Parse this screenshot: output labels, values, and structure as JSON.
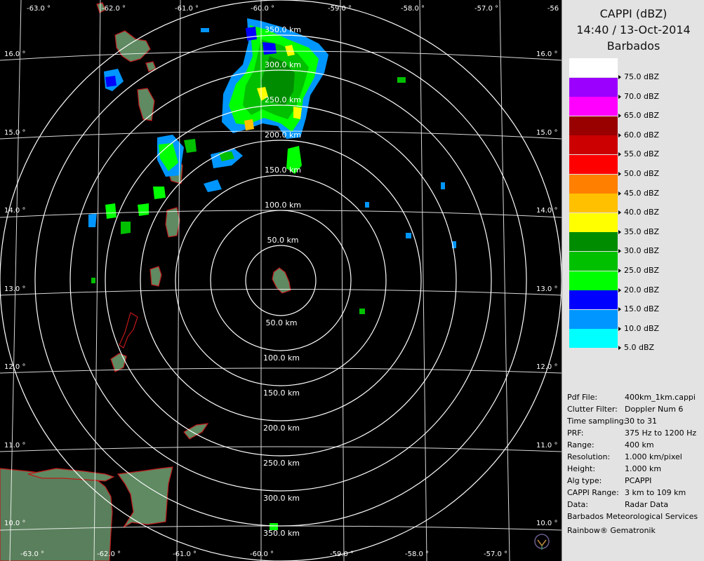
{
  "header": {
    "product": "CAPPI (dBZ)",
    "datetime": "14:40 / 13-Oct-2014",
    "site": "Barbados"
  },
  "legend": [
    {
      "label": "75.0 dBZ",
      "color": "#ffffff"
    },
    {
      "label": "70.0 dBZ",
      "color": "#9b00ff"
    },
    {
      "label": "65.0 dBZ",
      "color": "#ff00ff"
    },
    {
      "label": "60.0 dBZ",
      "color": "#990000"
    },
    {
      "label": "55.0 dBZ",
      "color": "#cc0000"
    },
    {
      "label": "50.0 dBZ",
      "color": "#ff0000"
    },
    {
      "label": "45.0 dBZ",
      "color": "#ff7f00"
    },
    {
      "label": "40.0 dBZ",
      "color": "#ffc000"
    },
    {
      "label": "35.0 dBZ",
      "color": "#ffff00"
    },
    {
      "label": "30.0 dBZ",
      "color": "#008c00"
    },
    {
      "label": "25.0 dBZ",
      "color": "#00c000"
    },
    {
      "label": "20.0 dBZ",
      "color": "#00ff00"
    },
    {
      "label": "15.0 dBZ",
      "color": "#0000ff"
    },
    {
      "label": "10.0 dBZ",
      "color": "#0096ff"
    },
    {
      "label": "5.0 dBZ",
      "color": "#00ffff"
    }
  ],
  "info": [
    {
      "key": "Pdf File:",
      "value": "400km_1km.cappi"
    },
    {
      "key": "Clutter Filter:",
      "value": "Doppler Num 6"
    },
    {
      "key": "Time sampling:",
      "value": "30 to 31"
    },
    {
      "key": "PRF:",
      "value": "375 Hz to 1200 Hz"
    },
    {
      "key": "Range:",
      "value": "400 km"
    },
    {
      "key": "Resolution:",
      "value": "1.000 km/pixel"
    },
    {
      "key": "Height:",
      "value": "1.000 km"
    },
    {
      "key": "Alg type:",
      "value": "PCAPPI"
    },
    {
      "key": "CAPPI Range:",
      "value": "3 km to 109 km"
    },
    {
      "key": "Data:",
      "value": "Radar Data"
    }
  ],
  "credits": {
    "organization": "Barbados Meteorological Services",
    "software": "Rainbow® Gematronik"
  },
  "map": {
    "range_rings": [
      {
        "label_north": "50.0 km",
        "label_south": "50.0 km"
      },
      {
        "label_north": "100.0 km",
        "label_south": "100.0 km"
      },
      {
        "label_north": "150.0 km",
        "label_south": "150.0 km"
      },
      {
        "label_north": "200.0 km",
        "label_south": "200.0 km"
      },
      {
        "label_north": "250.0 km",
        "label_south": "250.0 km"
      },
      {
        "label_north": "300.0 km",
        "label_south": "300.0 km"
      },
      {
        "label_north": "350.0 km",
        "label_south": "350.0 km"
      }
    ],
    "longitudes_top": [
      "-63.0 °",
      "-62.0 °",
      "-61.0 °",
      "-60.0 °",
      "-59.0 °",
      "-58.0 °",
      "-57.0 °",
      "-56"
    ],
    "longitudes_bottom": [
      "-63.0 °",
      "-62.0 °",
      "-61.0 °",
      "-60.0 °",
      "-59.0 °",
      "-58.0 °",
      "-57.0 °"
    ],
    "latitudes_left": [
      "16.0 °",
      "15.0 °",
      "14.0 °",
      "13.0 °",
      "12.0 °",
      "11.0 °",
      "10.0 °"
    ],
    "latitudes_right": [
      "16.0 °",
      "15.0 °",
      "14.0 °",
      "13.0 °",
      "12.0 °",
      "11.0 °",
      "10.0 °"
    ],
    "colors": {
      "background": "#000000",
      "land": "#5f8a62",
      "coast": "#c0181a",
      "grid": "#ffffff"
    }
  }
}
